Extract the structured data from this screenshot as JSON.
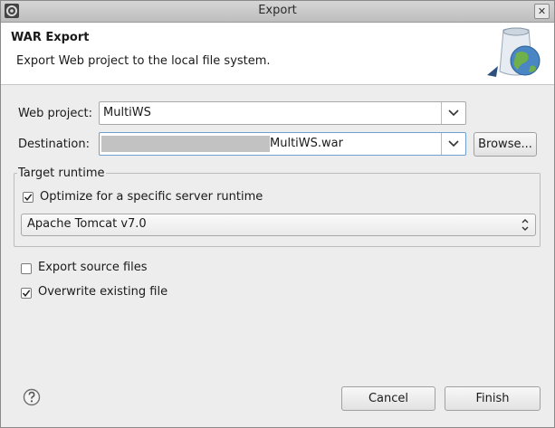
{
  "window": {
    "title": "Export"
  },
  "banner": {
    "heading": "WAR Export",
    "description": "Export Web project to the local file system."
  },
  "form": {
    "web_project_label": "Web project:",
    "web_project_value": "MultiWS",
    "destination_label": "Destination:",
    "destination_value": "MultiWS.war",
    "browse_label": "Browse..."
  },
  "target_runtime": {
    "group_label": "Target runtime",
    "optimize_label": "Optimize for a specific server runtime",
    "optimize_checked": true,
    "runtime_value": "Apache Tomcat v7.0"
  },
  "options": {
    "export_source_label": "Export source files",
    "export_source_checked": false,
    "overwrite_label": "Overwrite existing file",
    "overwrite_checked": true
  },
  "buttons": {
    "cancel_label": "Cancel",
    "finish_label": "Finish"
  },
  "icons": {
    "app": "gear-icon",
    "close": "close-icon",
    "banner": "war-export-globe-icon",
    "help": "help-icon"
  }
}
